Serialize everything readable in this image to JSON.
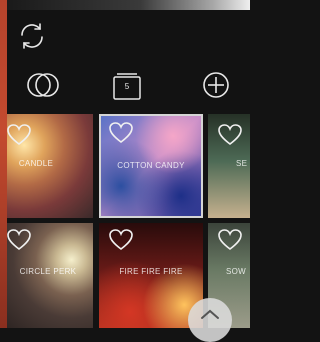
{
  "toolbar": {
    "layer_count": "5",
    "icons": [
      "refresh-icon",
      "blend-icon",
      "layers-icon",
      "add-icon"
    ]
  },
  "filters": [
    {
      "label": "CANDLE"
    },
    {
      "label": "COTTON CANDY"
    },
    {
      "label": "SE"
    },
    {
      "label": "CIRCLE PERK"
    },
    {
      "label": "FIRE FIRE FIRE"
    },
    {
      "label": "SOW"
    }
  ],
  "selected_filter": "COTTON CANDY",
  "colors": {
    "accent_strip": "#c44a2f",
    "background": "#131313",
    "selected_border": "#d5d5d5"
  }
}
